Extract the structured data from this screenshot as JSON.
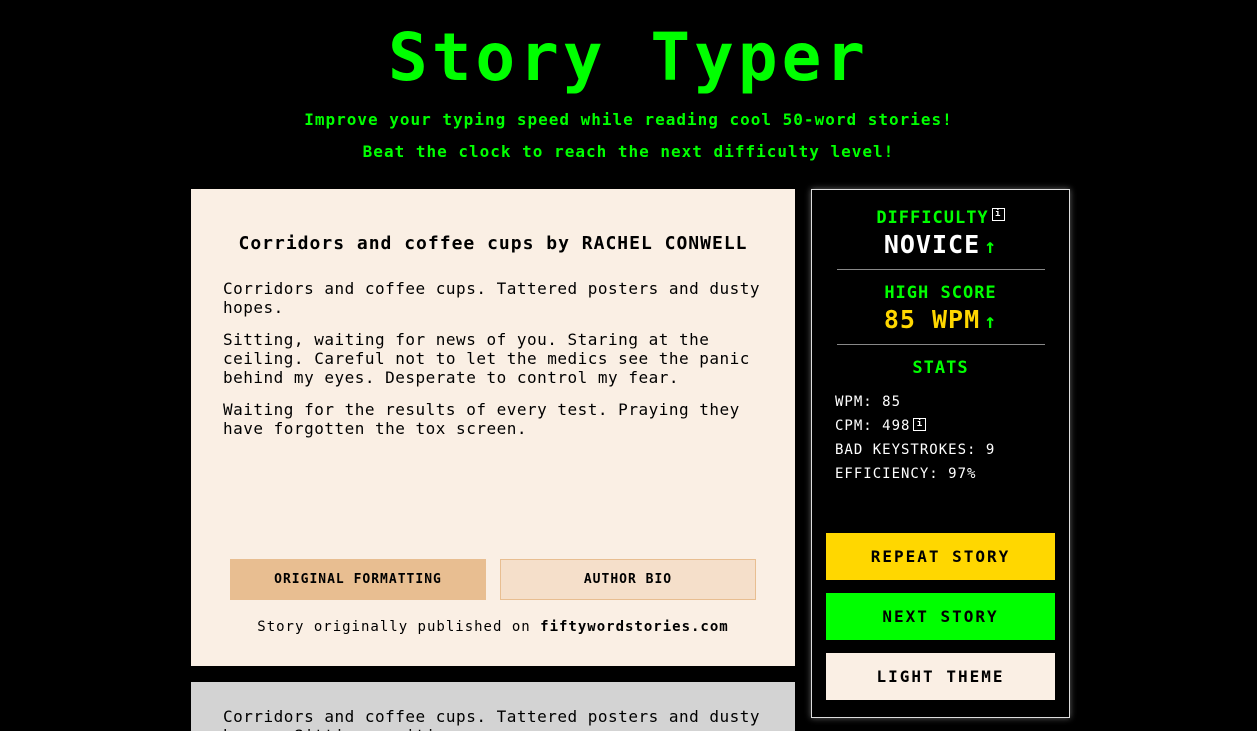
{
  "header": {
    "title": "Story Typer",
    "subtitle_line1": "Improve your typing speed while reading cool 50-word stories!",
    "subtitle_line2": "Beat the clock to reach the next difficulty level!"
  },
  "story": {
    "title": "Corridors and coffee cups by RACHEL CONWELL",
    "paragraphs": [
      "Corridors and coffee cups. Tattered posters and dusty hopes.",
      "Sitting, waiting for news of you. Staring at the ceiling. Careful not to let the medics see the panic behind my eyes. Desperate to control my fear.",
      "Waiting for the results of every test. Praying they have forgotten the tox screen."
    ],
    "original_formatting_label": "ORIGINAL FORMATTING",
    "author_bio_label": "AUTHOR BIO",
    "published_prefix": "Story originally published on ",
    "published_site": "fiftywordstories.com"
  },
  "typing": {
    "text": "Corridors and coffee cups. Tattered posters and dusty hopes. Sitting, waiting"
  },
  "panel": {
    "difficulty_label": "DIFFICULTY",
    "difficulty_value": "NOVICE",
    "high_score_label": "HIGH SCORE",
    "high_score_value": "85 WPM",
    "stats_label": "STATS",
    "wpm": "WPM: 85",
    "cpm": "CPM: 498",
    "bad_keystrokes": "BAD KEYSTROKES: 9",
    "efficiency": "EFFICIENCY: 97%",
    "info_glyph": "i",
    "up_arrow": "↑",
    "repeat_label": "REPEAT STORY",
    "next_label": "NEXT STORY",
    "theme_label": "LIGHT THEME"
  },
  "colors": {
    "accent_green": "#00ff00",
    "gold": "#ffd700",
    "card_bg": "#faefe4",
    "typing_bg": "#d3d3d3"
  }
}
